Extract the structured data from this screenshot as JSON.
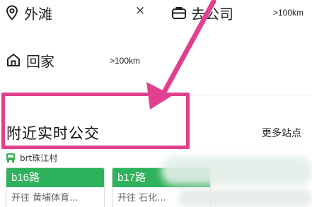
{
  "favorites": [
    {
      "name": "外滩",
      "icon": "location-pin-icon",
      "action": "×"
    },
    {
      "name": "去公司",
      "icon": "briefcase-icon",
      "distance": ">100km"
    },
    {
      "name": "回家",
      "icon": "home-icon",
      "distance": ">100km"
    }
  ],
  "nearby": {
    "title": "附近实时公交",
    "more": "更多站点",
    "stop": {
      "icon": "bus-stop-icon",
      "name": "brt珠江村"
    },
    "routes": [
      {
        "name": "b16路",
        "direction": "开往 黄埔体育..."
      },
      {
        "name": "b17路",
        "direction": "开往 石化..."
      }
    ]
  },
  "colors": {
    "annotation": "#e0408f",
    "route_green": "#2fb25c",
    "stop_green": "#35b04f"
  }
}
